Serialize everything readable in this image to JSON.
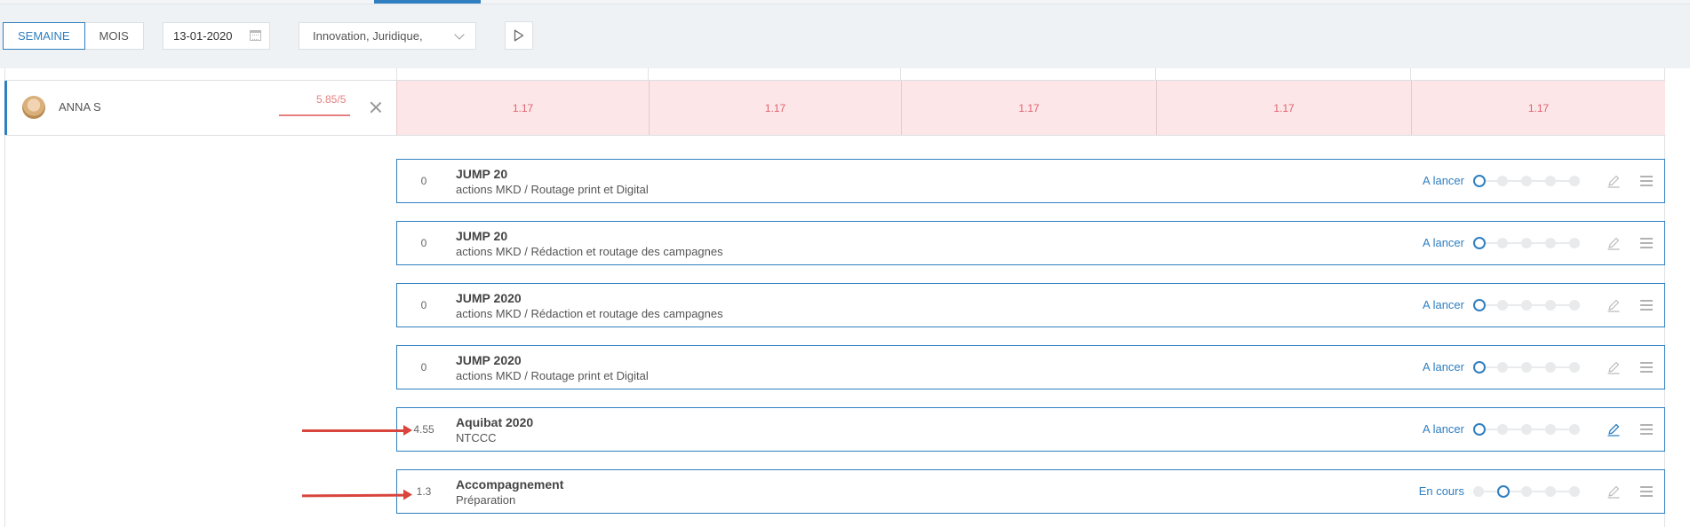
{
  "toolbar": {
    "view_week": "SEMAINE",
    "view_month": "MOIS",
    "date_value": "13-01-2020",
    "department_value": "Innovation, Juridique,"
  },
  "person": {
    "name": "ANNA S",
    "load": "5.85/5",
    "days": [
      "1.17",
      "1.17",
      "1.17",
      "1.17",
      "1.17"
    ]
  },
  "tasks": [
    {
      "hours": "0",
      "title": "JUMP 20",
      "subtitle": "actions MKD / Routage print et Digital",
      "status": "A lancer",
      "step": 0
    },
    {
      "hours": "0",
      "title": "JUMP 20",
      "subtitle": "actions MKD / Rédaction et routage des campagnes",
      "status": "A lancer",
      "step": 0
    },
    {
      "hours": "0",
      "title": "JUMP 2020",
      "subtitle": "actions MKD / Rédaction et routage des campagnes",
      "status": "A lancer",
      "step": 0
    },
    {
      "hours": "0",
      "title": "JUMP 2020",
      "subtitle": "actions MKD / Routage print et Digital",
      "status": "A lancer",
      "step": 0
    },
    {
      "hours": "4.55",
      "title": "Aquibat 2020",
      "subtitle": "NTCCC",
      "status": "A lancer",
      "step": 0
    },
    {
      "hours": "1.3",
      "title": "Accompagnement",
      "subtitle": "Préparation",
      "status": "En cours",
      "step": 1
    }
  ],
  "colors": {
    "accent": "#2f7fc1",
    "overload_bg": "#fde6e8",
    "overload_text": "#e0626e",
    "annotation": "#d9453c"
  }
}
